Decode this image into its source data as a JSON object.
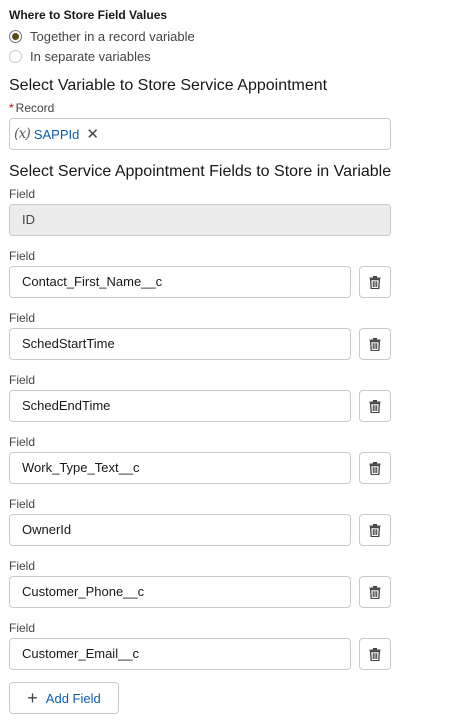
{
  "store_values": {
    "title": "Where to Store Field Values",
    "options": [
      {
        "label": "Together in a record variable",
        "checked": true
      },
      {
        "label": "In separate variables",
        "checked": false
      }
    ]
  },
  "select_variable": {
    "heading": "Select Variable to Store Service Appointment",
    "required_marker": "*",
    "record_label": "Record",
    "record_icon": "(x)",
    "record_value": "SAPPId",
    "remove_glyph": "✕"
  },
  "select_fields": {
    "heading": "Select Service Appointment Fields to Store in Variable",
    "id_field": {
      "label": "Field",
      "value": "ID"
    },
    "fields": [
      {
        "label": "Field",
        "value": "Contact_First_Name__c"
      },
      {
        "label": "Field",
        "value": "SchedStartTime"
      },
      {
        "label": "Field",
        "value": "SchedEndTime"
      },
      {
        "label": "Field",
        "value": "Work_Type_Text__c"
      },
      {
        "label": "Field",
        "value": "OwnerId"
      },
      {
        "label": "Field",
        "value": "Customer_Phone__c"
      },
      {
        "label": "Field",
        "value": "Customer_Email__c"
      }
    ],
    "add_button": {
      "icon": "+",
      "label": "Add Field"
    }
  },
  "colors": {
    "link_blue": "#0b5cab",
    "required_red": "#ba0517",
    "border": "#c9c9c9",
    "disabled_bg": "#ececec"
  }
}
